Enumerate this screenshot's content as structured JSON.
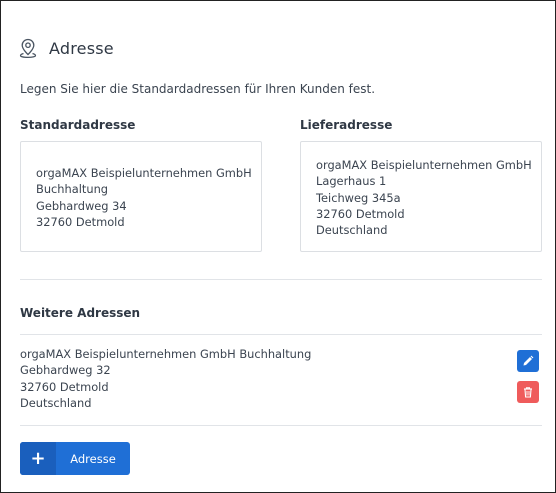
{
  "section": {
    "title": "Adresse",
    "description": "Legen Sie hier die Standardadressen für Ihren Kunden fest."
  },
  "standard": {
    "heading": "Standardadresse",
    "lines": [
      "orgaMAX Beispielunternehmen GmbH",
      "Buchhaltung",
      "Gebhardweg 34",
      "32760 Detmold"
    ]
  },
  "delivery": {
    "heading": "Lieferadresse",
    "lines": [
      "orgaMAX Beispielunternehmen GmbH",
      "Lagerhaus 1",
      "Teichweg 345a",
      "32760 Detmold",
      "Deutschland"
    ]
  },
  "more": {
    "heading": "Weitere Adressen",
    "items": [
      {
        "lines": [
          "orgaMAX Beispielunternehmen GmbH Buchhaltung",
          "Gebhardweg 32",
          "32760 Detmold",
          "Deutschland"
        ]
      }
    ]
  },
  "add_button": {
    "icon": "+",
    "label": "Adresse"
  },
  "colors": {
    "primary": "#1f6fd6",
    "danger": "#ef5b5b"
  },
  "icons": {
    "header": "map-pin-icon",
    "edit": "pencil-icon",
    "delete": "trash-icon",
    "add": "plus-icon"
  }
}
